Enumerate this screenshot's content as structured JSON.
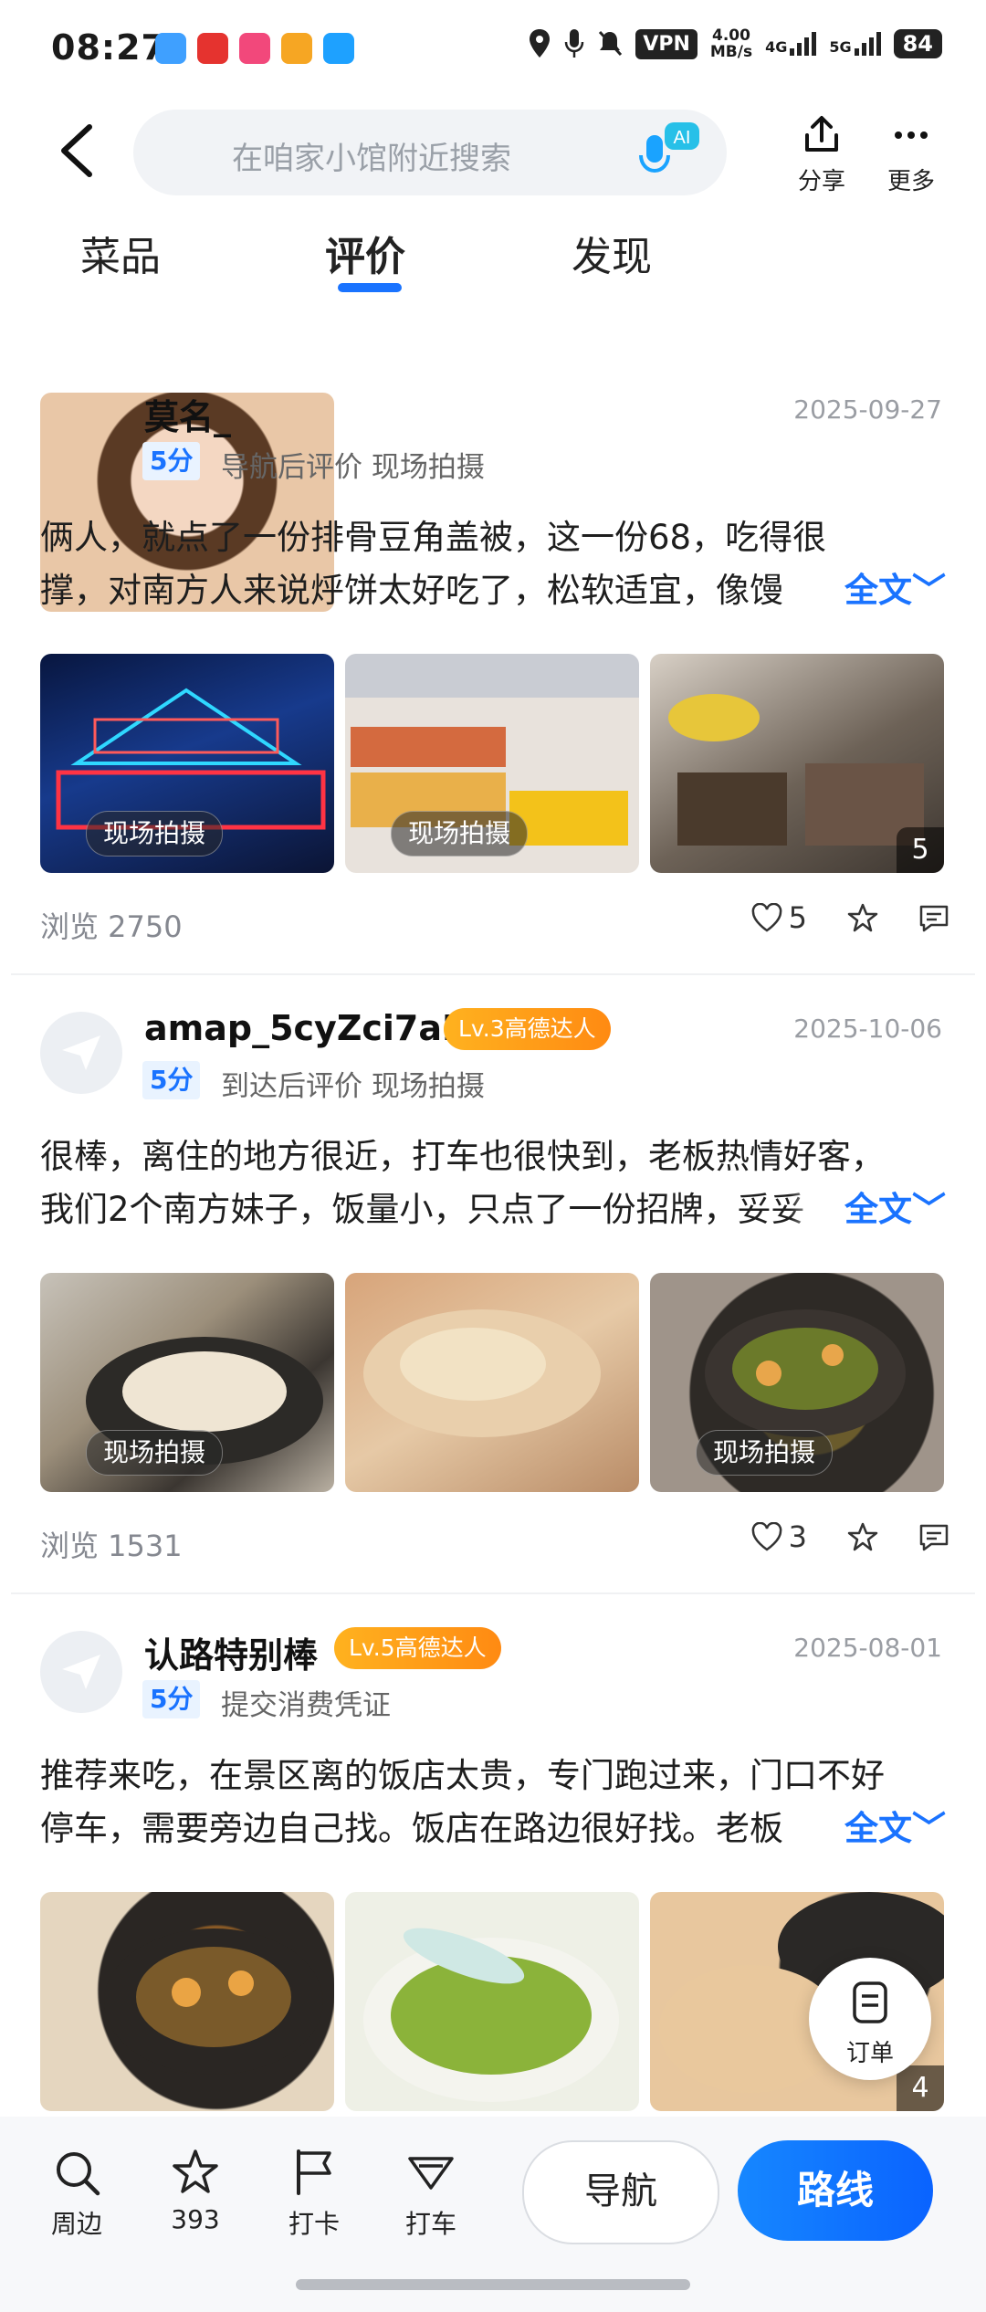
{
  "status_bar": {
    "time": "08:27",
    "vpn": "VPN",
    "speed_value": "4.00",
    "speed_unit": "MB/s",
    "net1": "4G",
    "net2": "5G",
    "battery": "84"
  },
  "header": {
    "search_placeholder": "在咱家小馆附近搜索",
    "ai_label": "AI",
    "share_label": "分享",
    "more_label": "更多"
  },
  "tabs": [
    {
      "label": "菜品",
      "active": false
    },
    {
      "label": "评价",
      "active": true
    },
    {
      "label": "发现",
      "active": false
    }
  ],
  "reviews": [
    {
      "username": "莫名_",
      "level": "",
      "date": "2025-09-27",
      "score": "5分",
      "meta": "导航后评价  现场拍摄",
      "line1": "俩人，就点了一份排骨豆角盖被，这一份68，吃得很",
      "line2": "撑，对南方人来说烀饼太好吃了，松软适宜，像馒",
      "full_text": "全文",
      "photos": [
        {
          "tag": "现场拍摄",
          "count": ""
        },
        {
          "tag": "现场拍摄",
          "count": ""
        },
        {
          "tag": "",
          "count": "5"
        }
      ],
      "views": "浏览 2750",
      "likes": "5"
    },
    {
      "username": "amap_5cyZci7aHi",
      "level": "Lv.3高德达人",
      "date": "2025-10-06",
      "score": "5分",
      "meta": "到达后评价  现场拍摄",
      "line1": "很棒，离住的地方很近，打车也很快到，老板热情好客，",
      "line2": "我们2个南方妹子，饭量小，只点了一份招牌，妥妥",
      "full_text": "全文",
      "photos": [
        {
          "tag": "现场拍摄",
          "count": ""
        },
        {
          "tag": "",
          "count": ""
        },
        {
          "tag": "现场拍摄",
          "count": ""
        }
      ],
      "views": "浏览 1531",
      "likes": "3"
    },
    {
      "username": "认路特别棒",
      "level": "Lv.5高德达人",
      "date": "2025-08-01",
      "score": "5分",
      "meta": "提交消费凭证",
      "line1": "推荐来吃，在景区离的饭店太贵，专门跑过来，门口不好",
      "line2": "停车，需要旁边自己找。饭店在路边很好找。老板",
      "full_text": "全文",
      "photos": [
        {
          "tag": "",
          "count": ""
        },
        {
          "tag": "",
          "count": ""
        },
        {
          "tag": "",
          "count": "4"
        }
      ]
    }
  ],
  "floating": {
    "order_label": "订单"
  },
  "bottom_bar": {
    "nearby": "周边",
    "favorites": "393",
    "checkin": "打卡",
    "taxi": "打车",
    "navigate": "导航",
    "route": "路线"
  },
  "colors": {
    "accent": "#1a73ff",
    "level_badge": "#ff9a15"
  }
}
